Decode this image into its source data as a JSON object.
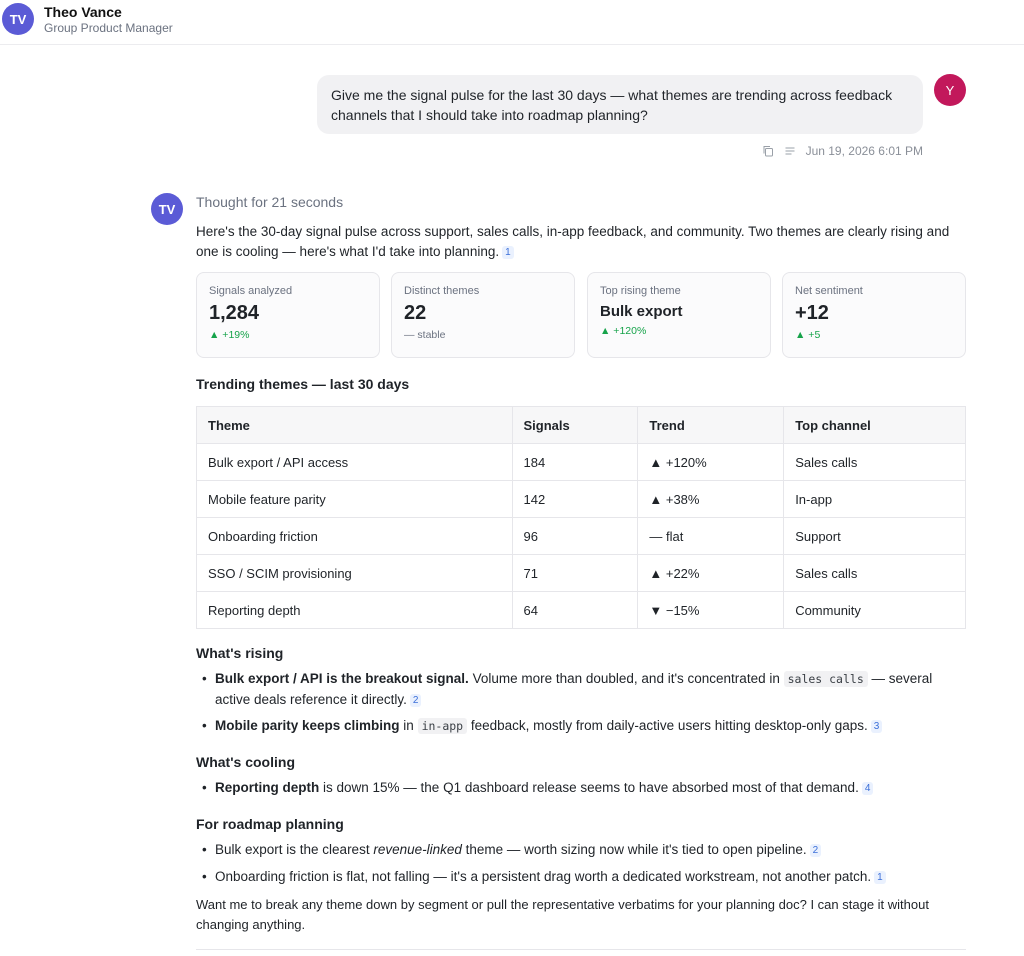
{
  "header": {
    "avatar_initials": "TV",
    "name": "Theo Vance",
    "role": "Group Product Manager",
    "avatar_color": "#5b5bd6"
  },
  "user_message": {
    "avatar_initial": "Y",
    "avatar_color": "#c2185b",
    "text": "Give me the signal pulse for the last 30 days — what themes are trending across feedback channels that I should take into roadmap planning?",
    "timestamp": "Jun 19, 2026 6:01 PM",
    "icons": [
      "copy-icon",
      "text-lines-icon"
    ]
  },
  "assistant": {
    "avatar_initials": "TV",
    "thought": "Thought for 21 seconds",
    "intro": "Here's the 30-day signal pulse across support, sales calls, in-app feedback, and community. Two themes are clearly rising and one is cooling — here's what I'd take into planning.",
    "intro_cite": "1",
    "stats": [
      {
        "label": "Signals analyzed",
        "value": "1,284",
        "delta": "▲ +19%",
        "trend": "up"
      },
      {
        "label": "Distinct themes",
        "value": "22",
        "delta": "— stable",
        "trend": "flat"
      },
      {
        "label": "Top rising theme",
        "value": "Bulk export",
        "delta": "▲ +120%",
        "trend": "up"
      },
      {
        "label": "Net sentiment",
        "value": "+12",
        "delta": "▲ +5",
        "trend": "up"
      }
    ],
    "table_title": "Trending themes — last 30 days",
    "table": {
      "headers": [
        "Theme",
        "Signals",
        "Trend",
        "Top channel"
      ],
      "rows": [
        {
          "theme": "Bulk export / API access",
          "signals": "184",
          "trend": "▲ +120%",
          "dir": "up",
          "channel": "Sales calls"
        },
        {
          "theme": "Mobile feature parity",
          "signals": "142",
          "trend": "▲ +38%",
          "dir": "up",
          "channel": "In-app"
        },
        {
          "theme": "Onboarding friction",
          "signals": "96",
          "trend": "— flat",
          "dir": "flat",
          "channel": "Support"
        },
        {
          "theme": "SSO / SCIM provisioning",
          "signals": "71",
          "trend": "▲ +22%",
          "dir": "up",
          "channel": "Sales calls"
        },
        {
          "theme": "Reporting depth",
          "signals": "64",
          "trend": "▼ −15%",
          "dir": "down",
          "channel": "Community"
        }
      ]
    },
    "rising": {
      "title": "What's rising",
      "b1_bold": "Bulk export / API is the breakout signal.",
      "b1_pre": " Volume more than doubled, and it's concentrated in ",
      "b1_code": "sales calls",
      "b1_post": " — several active deals reference it directly.",
      "b1_cite": "2",
      "b2_bold": "Mobile parity keeps climbing",
      "b2_pre": " in ",
      "b2_code": "in-app",
      "b2_post": " feedback, mostly from daily-active users hitting desktop-only gaps.",
      "b2_cite": "3"
    },
    "cooling": {
      "title": "What's cooling",
      "b1_bold": "Reporting depth",
      "b1_post": " is down 15% — the Q1 dashboard release seems to have absorbed most of that demand.",
      "b1_cite": "4"
    },
    "planning": {
      "title": "For roadmap planning",
      "b1_pre": "Bulk export is the clearest ",
      "b1_em": "revenue-linked",
      "b1_post": " theme — worth sizing now while it's tied to open pipeline.",
      "b1_cite": "2",
      "b2_text": "Onboarding friction is flat, not falling — it's a persistent drag worth a dedicated workstream, not another patch.",
      "b2_cite": "1"
    },
    "closing": "Want me to break any theme down by segment or pull the representative verbatims for your planning doc? I can stage it without changing anything."
  }
}
